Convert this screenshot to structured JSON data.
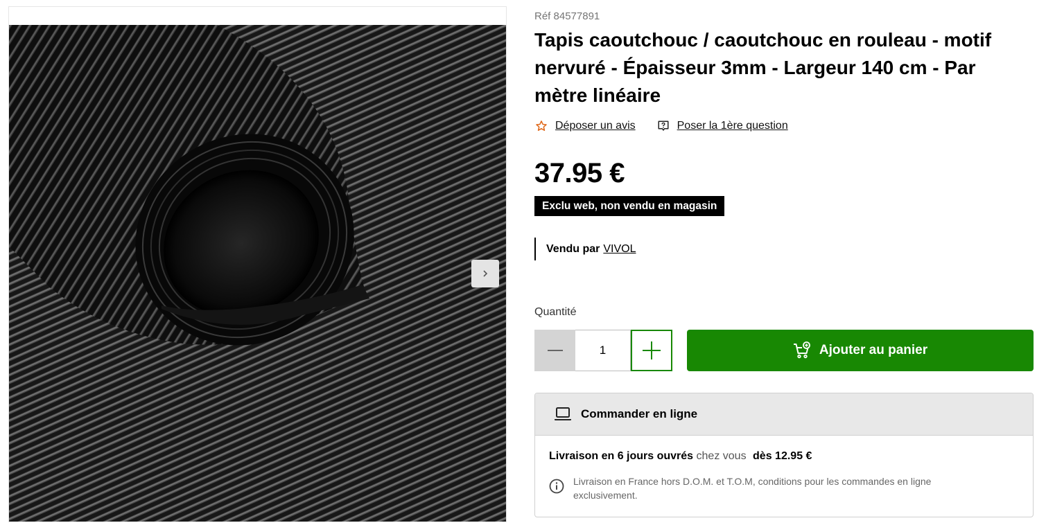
{
  "product": {
    "ref": "Réf 84577891",
    "title": "Tapis caoutchouc / caoutchouc en rouleau - motif nervuré - Épaisseur 3mm - Largeur 140 cm - Par mètre linéaire",
    "image_icon": "rubber-mat-roll-photo",
    "links": {
      "review": "Déposer un avis",
      "question": "Poser la 1ère question"
    },
    "price": "37.95 €",
    "badge": "Exclu web, non vendu en magasin",
    "seller_prefix": "Vendu par",
    "seller_name": "VIVOL"
  },
  "purchase": {
    "quantity_label": "Quantité",
    "quantity_value": "1",
    "add_to_cart": "Ajouter au panier"
  },
  "delivery": {
    "header": "Commander en ligne",
    "line_bold": "Livraison en 6 jours ouvrés",
    "line_muted": "chez vous",
    "price_from": "dès 12.95 €",
    "note": "Livraison en France hors D.O.M. et T.O.M, conditions pour les commandes en ligne exclusivement."
  },
  "colors": {
    "accent_green": "#188803",
    "review_star": "#e0691b",
    "badge_bg": "#000000"
  },
  "icons": [
    "star-icon",
    "question-icon",
    "minus-icon",
    "plus-icon",
    "cart-icon",
    "laptop-icon",
    "info-icon",
    "chevron-right-icon"
  ]
}
